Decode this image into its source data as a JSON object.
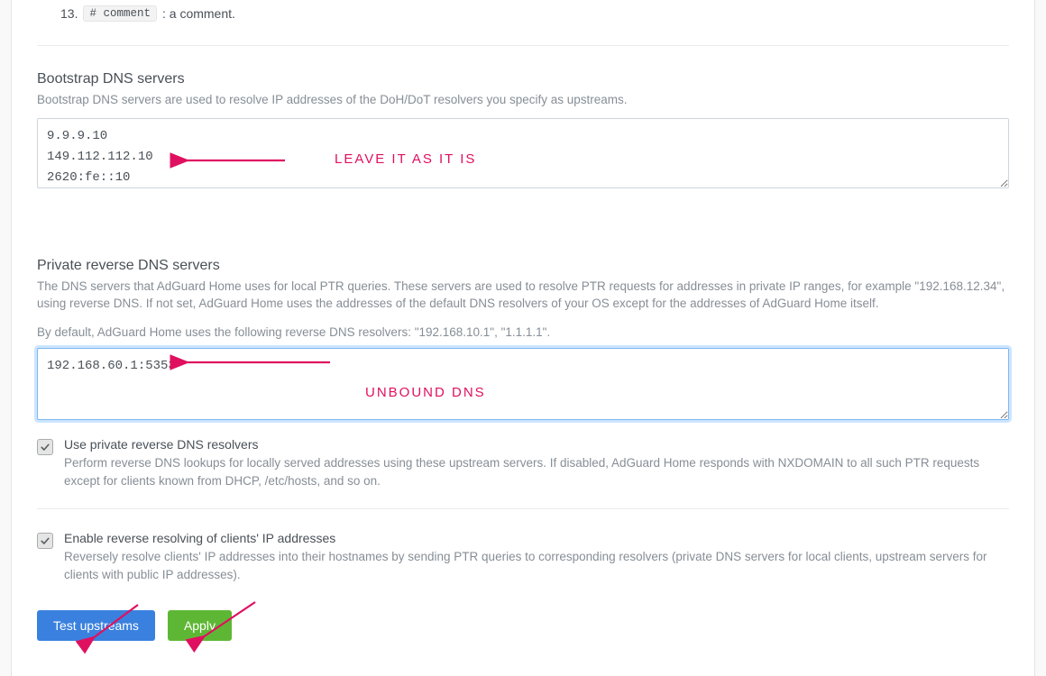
{
  "list13": {
    "number": "13.",
    "code": "# comment",
    "after": ": a comment."
  },
  "bootstrap": {
    "title": "Bootstrap DNS servers",
    "desc": "Bootstrap DNS servers are used to resolve IP addresses of the DoH/DoT resolvers you specify as upstreams.",
    "value": "9.9.9.10\n149.112.112.10\n2620:fe::10"
  },
  "annotations": {
    "leave_as_is": "LEAVE IT AS IT IS",
    "unbound_dns": "UNBOUND DNS",
    "arrow_color": "#e01060"
  },
  "private": {
    "title": "Private reverse DNS servers",
    "desc": "The DNS servers that AdGuard Home uses for local PTR queries. These servers are used to resolve PTR requests for addresses in private IP ranges, for example \"192.168.12.34\", using reverse DNS. If not set, AdGuard Home uses the addresses of the default DNS resolvers of your OS except for the addresses of AdGuard Home itself.",
    "default_note": "By default, AdGuard Home uses the following reverse DNS resolvers: \"192.168.10.1\", \"1.1.1.1\".",
    "value": "192.168.60.1:5353"
  },
  "chk_private": {
    "label": "Use private reverse DNS resolvers",
    "desc": "Perform reverse DNS lookups for locally served addresses using these upstream servers. If disabled, AdGuard Home responds with NXDOMAIN to all such PTR requests except for clients known from DHCP, /etc/hosts, and so on."
  },
  "chk_reverse": {
    "label": "Enable reverse resolving of clients' IP addresses",
    "desc": "Reversely resolve clients' IP addresses into their hostnames by sending PTR queries to corresponding resolvers (private DNS servers for local clients, upstream servers for clients with public IP addresses)."
  },
  "buttons": {
    "test": "Test upstreams",
    "apply": "Apply"
  }
}
